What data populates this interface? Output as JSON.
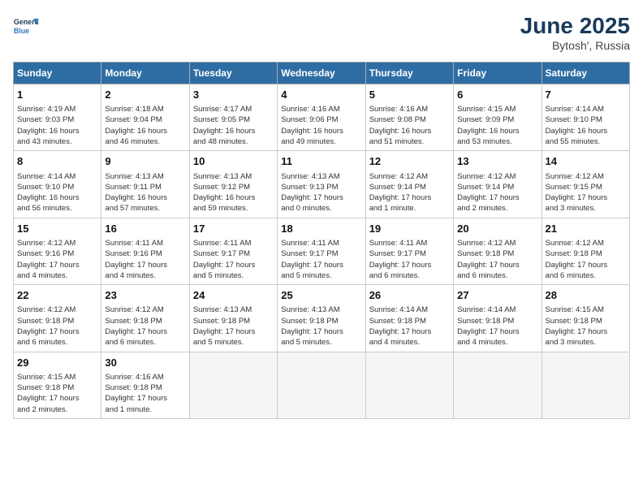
{
  "header": {
    "logo_line1": "General",
    "logo_line2": "Blue",
    "month_year": "June 2025",
    "location": "Bytosh', Russia"
  },
  "days_of_week": [
    "Sunday",
    "Monday",
    "Tuesday",
    "Wednesday",
    "Thursday",
    "Friday",
    "Saturday"
  ],
  "weeks": [
    [
      {
        "day": 1,
        "lines": [
          "Sunrise: 4:19 AM",
          "Sunset: 9:03 PM",
          "Daylight: 16 hours",
          "and 43 minutes."
        ]
      },
      {
        "day": 2,
        "lines": [
          "Sunrise: 4:18 AM",
          "Sunset: 9:04 PM",
          "Daylight: 16 hours",
          "and 46 minutes."
        ]
      },
      {
        "day": 3,
        "lines": [
          "Sunrise: 4:17 AM",
          "Sunset: 9:05 PM",
          "Daylight: 16 hours",
          "and 48 minutes."
        ]
      },
      {
        "day": 4,
        "lines": [
          "Sunrise: 4:16 AM",
          "Sunset: 9:06 PM",
          "Daylight: 16 hours",
          "and 49 minutes."
        ]
      },
      {
        "day": 5,
        "lines": [
          "Sunrise: 4:16 AM",
          "Sunset: 9:08 PM",
          "Daylight: 16 hours",
          "and 51 minutes."
        ]
      },
      {
        "day": 6,
        "lines": [
          "Sunrise: 4:15 AM",
          "Sunset: 9:09 PM",
          "Daylight: 16 hours",
          "and 53 minutes."
        ]
      },
      {
        "day": 7,
        "lines": [
          "Sunrise: 4:14 AM",
          "Sunset: 9:10 PM",
          "Daylight: 16 hours",
          "and 55 minutes."
        ]
      }
    ],
    [
      {
        "day": 8,
        "lines": [
          "Sunrise: 4:14 AM",
          "Sunset: 9:10 PM",
          "Daylight: 16 hours",
          "and 56 minutes."
        ]
      },
      {
        "day": 9,
        "lines": [
          "Sunrise: 4:13 AM",
          "Sunset: 9:11 PM",
          "Daylight: 16 hours",
          "and 57 minutes."
        ]
      },
      {
        "day": 10,
        "lines": [
          "Sunrise: 4:13 AM",
          "Sunset: 9:12 PM",
          "Daylight: 16 hours",
          "and 59 minutes."
        ]
      },
      {
        "day": 11,
        "lines": [
          "Sunrise: 4:13 AM",
          "Sunset: 9:13 PM",
          "Daylight: 17 hours",
          "and 0 minutes."
        ]
      },
      {
        "day": 12,
        "lines": [
          "Sunrise: 4:12 AM",
          "Sunset: 9:14 PM",
          "Daylight: 17 hours",
          "and 1 minute."
        ]
      },
      {
        "day": 13,
        "lines": [
          "Sunrise: 4:12 AM",
          "Sunset: 9:14 PM",
          "Daylight: 17 hours",
          "and 2 minutes."
        ]
      },
      {
        "day": 14,
        "lines": [
          "Sunrise: 4:12 AM",
          "Sunset: 9:15 PM",
          "Daylight: 17 hours",
          "and 3 minutes."
        ]
      }
    ],
    [
      {
        "day": 15,
        "lines": [
          "Sunrise: 4:12 AM",
          "Sunset: 9:16 PM",
          "Daylight: 17 hours",
          "and 4 minutes."
        ]
      },
      {
        "day": 16,
        "lines": [
          "Sunrise: 4:11 AM",
          "Sunset: 9:16 PM",
          "Daylight: 17 hours",
          "and 4 minutes."
        ]
      },
      {
        "day": 17,
        "lines": [
          "Sunrise: 4:11 AM",
          "Sunset: 9:17 PM",
          "Daylight: 17 hours",
          "and 5 minutes."
        ]
      },
      {
        "day": 18,
        "lines": [
          "Sunrise: 4:11 AM",
          "Sunset: 9:17 PM",
          "Daylight: 17 hours",
          "and 5 minutes."
        ]
      },
      {
        "day": 19,
        "lines": [
          "Sunrise: 4:11 AM",
          "Sunset: 9:17 PM",
          "Daylight: 17 hours",
          "and 6 minutes."
        ]
      },
      {
        "day": 20,
        "lines": [
          "Sunrise: 4:12 AM",
          "Sunset: 9:18 PM",
          "Daylight: 17 hours",
          "and 6 minutes."
        ]
      },
      {
        "day": 21,
        "lines": [
          "Sunrise: 4:12 AM",
          "Sunset: 9:18 PM",
          "Daylight: 17 hours",
          "and 6 minutes."
        ]
      }
    ],
    [
      {
        "day": 22,
        "lines": [
          "Sunrise: 4:12 AM",
          "Sunset: 9:18 PM",
          "Daylight: 17 hours",
          "and 6 minutes."
        ]
      },
      {
        "day": 23,
        "lines": [
          "Sunrise: 4:12 AM",
          "Sunset: 9:18 PM",
          "Daylight: 17 hours",
          "and 6 minutes."
        ]
      },
      {
        "day": 24,
        "lines": [
          "Sunrise: 4:13 AM",
          "Sunset: 9:18 PM",
          "Daylight: 17 hours",
          "and 5 minutes."
        ]
      },
      {
        "day": 25,
        "lines": [
          "Sunrise: 4:13 AM",
          "Sunset: 9:18 PM",
          "Daylight: 17 hours",
          "and 5 minutes."
        ]
      },
      {
        "day": 26,
        "lines": [
          "Sunrise: 4:14 AM",
          "Sunset: 9:18 PM",
          "Daylight: 17 hours",
          "and 4 minutes."
        ]
      },
      {
        "day": 27,
        "lines": [
          "Sunrise: 4:14 AM",
          "Sunset: 9:18 PM",
          "Daylight: 17 hours",
          "and 4 minutes."
        ]
      },
      {
        "day": 28,
        "lines": [
          "Sunrise: 4:15 AM",
          "Sunset: 9:18 PM",
          "Daylight: 17 hours",
          "and 3 minutes."
        ]
      }
    ],
    [
      {
        "day": 29,
        "lines": [
          "Sunrise: 4:15 AM",
          "Sunset: 9:18 PM",
          "Daylight: 17 hours",
          "and 2 minutes."
        ]
      },
      {
        "day": 30,
        "lines": [
          "Sunrise: 4:16 AM",
          "Sunset: 9:18 PM",
          "Daylight: 17 hours",
          "and 1 minute."
        ]
      },
      null,
      null,
      null,
      null,
      null
    ]
  ]
}
